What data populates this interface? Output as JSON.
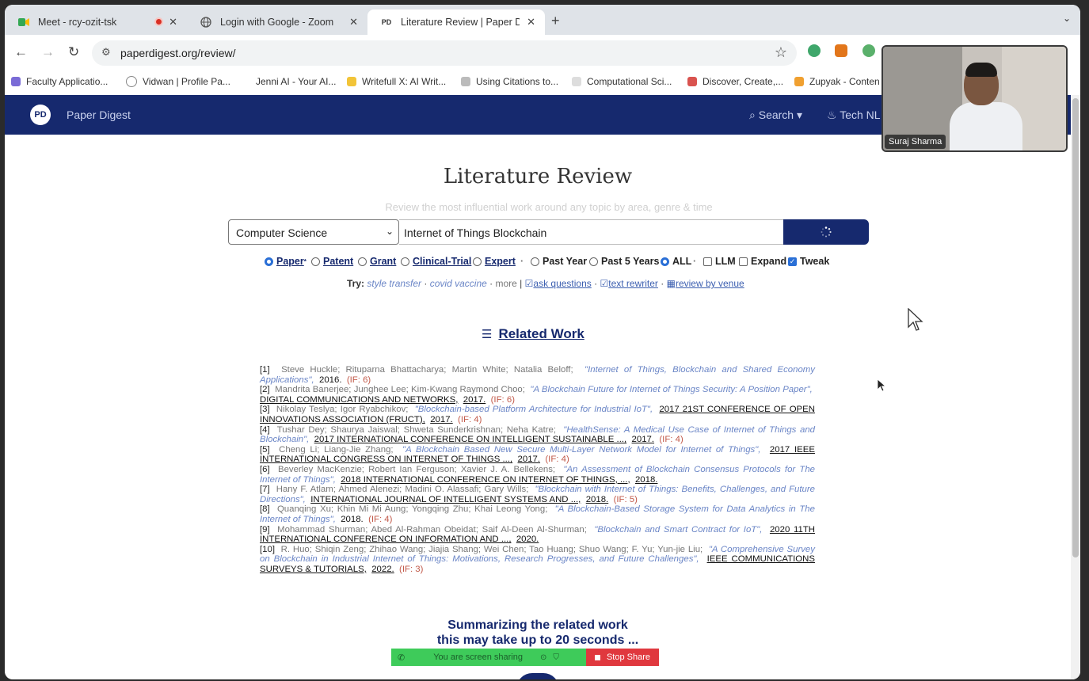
{
  "tabs": [
    {
      "title": "Meet - rcy-ozit-tsk",
      "icon": "meet-icon"
    },
    {
      "title": "Login with Google - Zoom",
      "icon": "globe-icon"
    },
    {
      "title": "Literature Review | Paper Dig",
      "icon": "paperdigest-icon",
      "active": true
    }
  ],
  "address_bar": {
    "url": "paperdigest.org/review/"
  },
  "bookmarks": [
    "Faculty Applicatio...",
    "Vidwan | Profile Pa...",
    "Jenni AI - Your AI...",
    "Writefull X: AI Writ...",
    "Using Citations to...",
    "Computational Sci...",
    "Discover, Create,...",
    "Zupyak - Conten"
  ],
  "site_nav": {
    "logo": "PD",
    "brand": "Paper Digest",
    "search": "Search",
    "tech": "Tech NL"
  },
  "page": {
    "title": "Literature Review",
    "tagline": "Review the most influential work around any topic by area, genre & time"
  },
  "form": {
    "area_selected": "Computer Science",
    "query": "Internet of Things Blockchain"
  },
  "options": {
    "paper": "Paper",
    "paper_sup": "*",
    "patent": "Patent",
    "grant": "Grant",
    "clinical": "Clinical-Trial",
    "expert": "Expert",
    "sep1": "·",
    "past_year": "Past Year",
    "past5": "Past 5 Years",
    "all": "ALL",
    "sep2": "·",
    "llm": "LLM",
    "expand": "Expand",
    "tweak": "Tweak"
  },
  "try_row": {
    "label": "Try:",
    "ex1": "style transfer",
    "dot1": "·",
    "ex2": "covid vaccine",
    "dot2": "·",
    "more": "more",
    "bar": "|",
    "ask": "ask questions",
    "dot3": "·",
    "rewriter": "text rewriter",
    "dot4": "·",
    "venue": "review by venue"
  },
  "related_heading": "Related Work",
  "references": [
    {
      "num": "[1]",
      "authors": "Steve Huckle; Rituparna Bhattacharya; Martin White; Natalia Beloff;",
      "title": "\"Internet of Things, Blockchain and Shared Economy Applications\",",
      "venue": "",
      "year": "2016.",
      "if": "(IF: 6)"
    },
    {
      "num": "[2]",
      "authors": "Mandrita Banerjee; Junghee Lee; Kim-Kwang Raymond Choo;",
      "title": "\"A Blockchain Future for Internet of Things Security: A Position Paper\",",
      "venue": "DIGITAL COMMUNICATIONS AND NETWORKS,",
      "year": "2017.",
      "if": "(IF: 6)"
    },
    {
      "num": "[3]",
      "authors": "Nikolay Teslya; Igor Ryabchikov;",
      "title": "\"Blockchain-based Platform Architecture for Industrial IoT\",",
      "venue": "2017 21ST CONFERENCE OF OPEN INNOVATIONS ASSOCIATION (FRUCT),",
      "year": "2017.",
      "if": "(IF: 4)"
    },
    {
      "num": "[4]",
      "authors": "Tushar Dey; Shaurya Jaiswal; Shweta Sunderkrishnan; Neha Katre;",
      "title": "\"HealthSense: A Medical Use Case of Internet of Things and Blockchain\",",
      "venue": "2017 INTERNATIONAL CONFERENCE ON INTELLIGENT SUSTAINABLE ...,",
      "year": "2017.",
      "if": "(IF: 4)"
    },
    {
      "num": "[5]",
      "authors": "Cheng Li; Liang-Jie Zhang;",
      "title": "\"A Blockchain Based New Secure Multi-Layer Network Model for Internet of Things\",",
      "venue": "2017 IEEE INTERNATIONAL CONGRESS ON INTERNET OF THINGS ...,",
      "year": "2017.",
      "if": "(IF: 4)"
    },
    {
      "num": "[6]",
      "authors": "Beverley MacKenzie; Robert Ian Ferguson; Xavier J. A. Bellekens;",
      "title": "\"An Assessment of Blockchain Consensus Protocols for The Internet of Things\",",
      "venue": "2018 INTERNATIONAL CONFERENCE ON INTERNET OF THINGS, ...,",
      "year": "2018.",
      "if": ""
    },
    {
      "num": "[7]",
      "authors": "Hany F. Atlam; Ahmed Alenezi; Madini O. Alassafi; Gary Wills;",
      "title": "\"Blockchain with Internet of Things: Benefits, Challenges, and Future Directions\",",
      "venue": "INTERNATIONAL JOURNAL OF INTELLIGENT SYSTEMS AND ...,",
      "year": "2018.",
      "if": "(IF: 5)"
    },
    {
      "num": "[8]",
      "authors": "Quanqing Xu; Khin Mi Mi Aung; Yongqing Zhu; Khai Leong Yong;",
      "title": "\"A Blockchain-Based Storage System for Data Analytics in The Internet of Things\",",
      "venue": "",
      "year": "2018.",
      "if": "(IF: 4)"
    },
    {
      "num": "[9]",
      "authors": "Mohammad Shurman; Abed Al-Rahman Obeidat; Saif Al-Deen Al-Shurman;",
      "title": "\"Blockchain and Smart Contract for IoT\",",
      "venue": "2020 11TH INTERNATIONAL CONFERENCE ON INFORMATION AND ...,",
      "year": "2020.",
      "if": ""
    },
    {
      "num": "[10]",
      "authors": "R. Huo; Shiqin Zeng; Zhihao Wang; Jiajia Shang; Wei Chen; Tao Huang; Shuo Wang; F. Yu; Yun-jie Liu;",
      "title": "\"A Comprehensive Survey on Blockchain in Industrial Internet of Things: Motivations, Research Progresses, and Future Challenges\",",
      "venue": "IEEE COMMUNICATIONS SURVEYS & TUTORIALS,",
      "year": "2022.",
      "if": "(IF: 3)"
    }
  ],
  "summary": {
    "line1": "Summarizing the related work",
    "line2": "this may take up to 20 seconds ..."
  },
  "share_bar": {
    "message": "You are screen sharing",
    "stop": "Stop Share"
  },
  "video": {
    "name": "Suraj Sharma"
  },
  "colors": {
    "nav": "#16296e",
    "share_green": "#3ecb5a",
    "share_red": "#e0383e",
    "link": "#3c5fb0"
  }
}
